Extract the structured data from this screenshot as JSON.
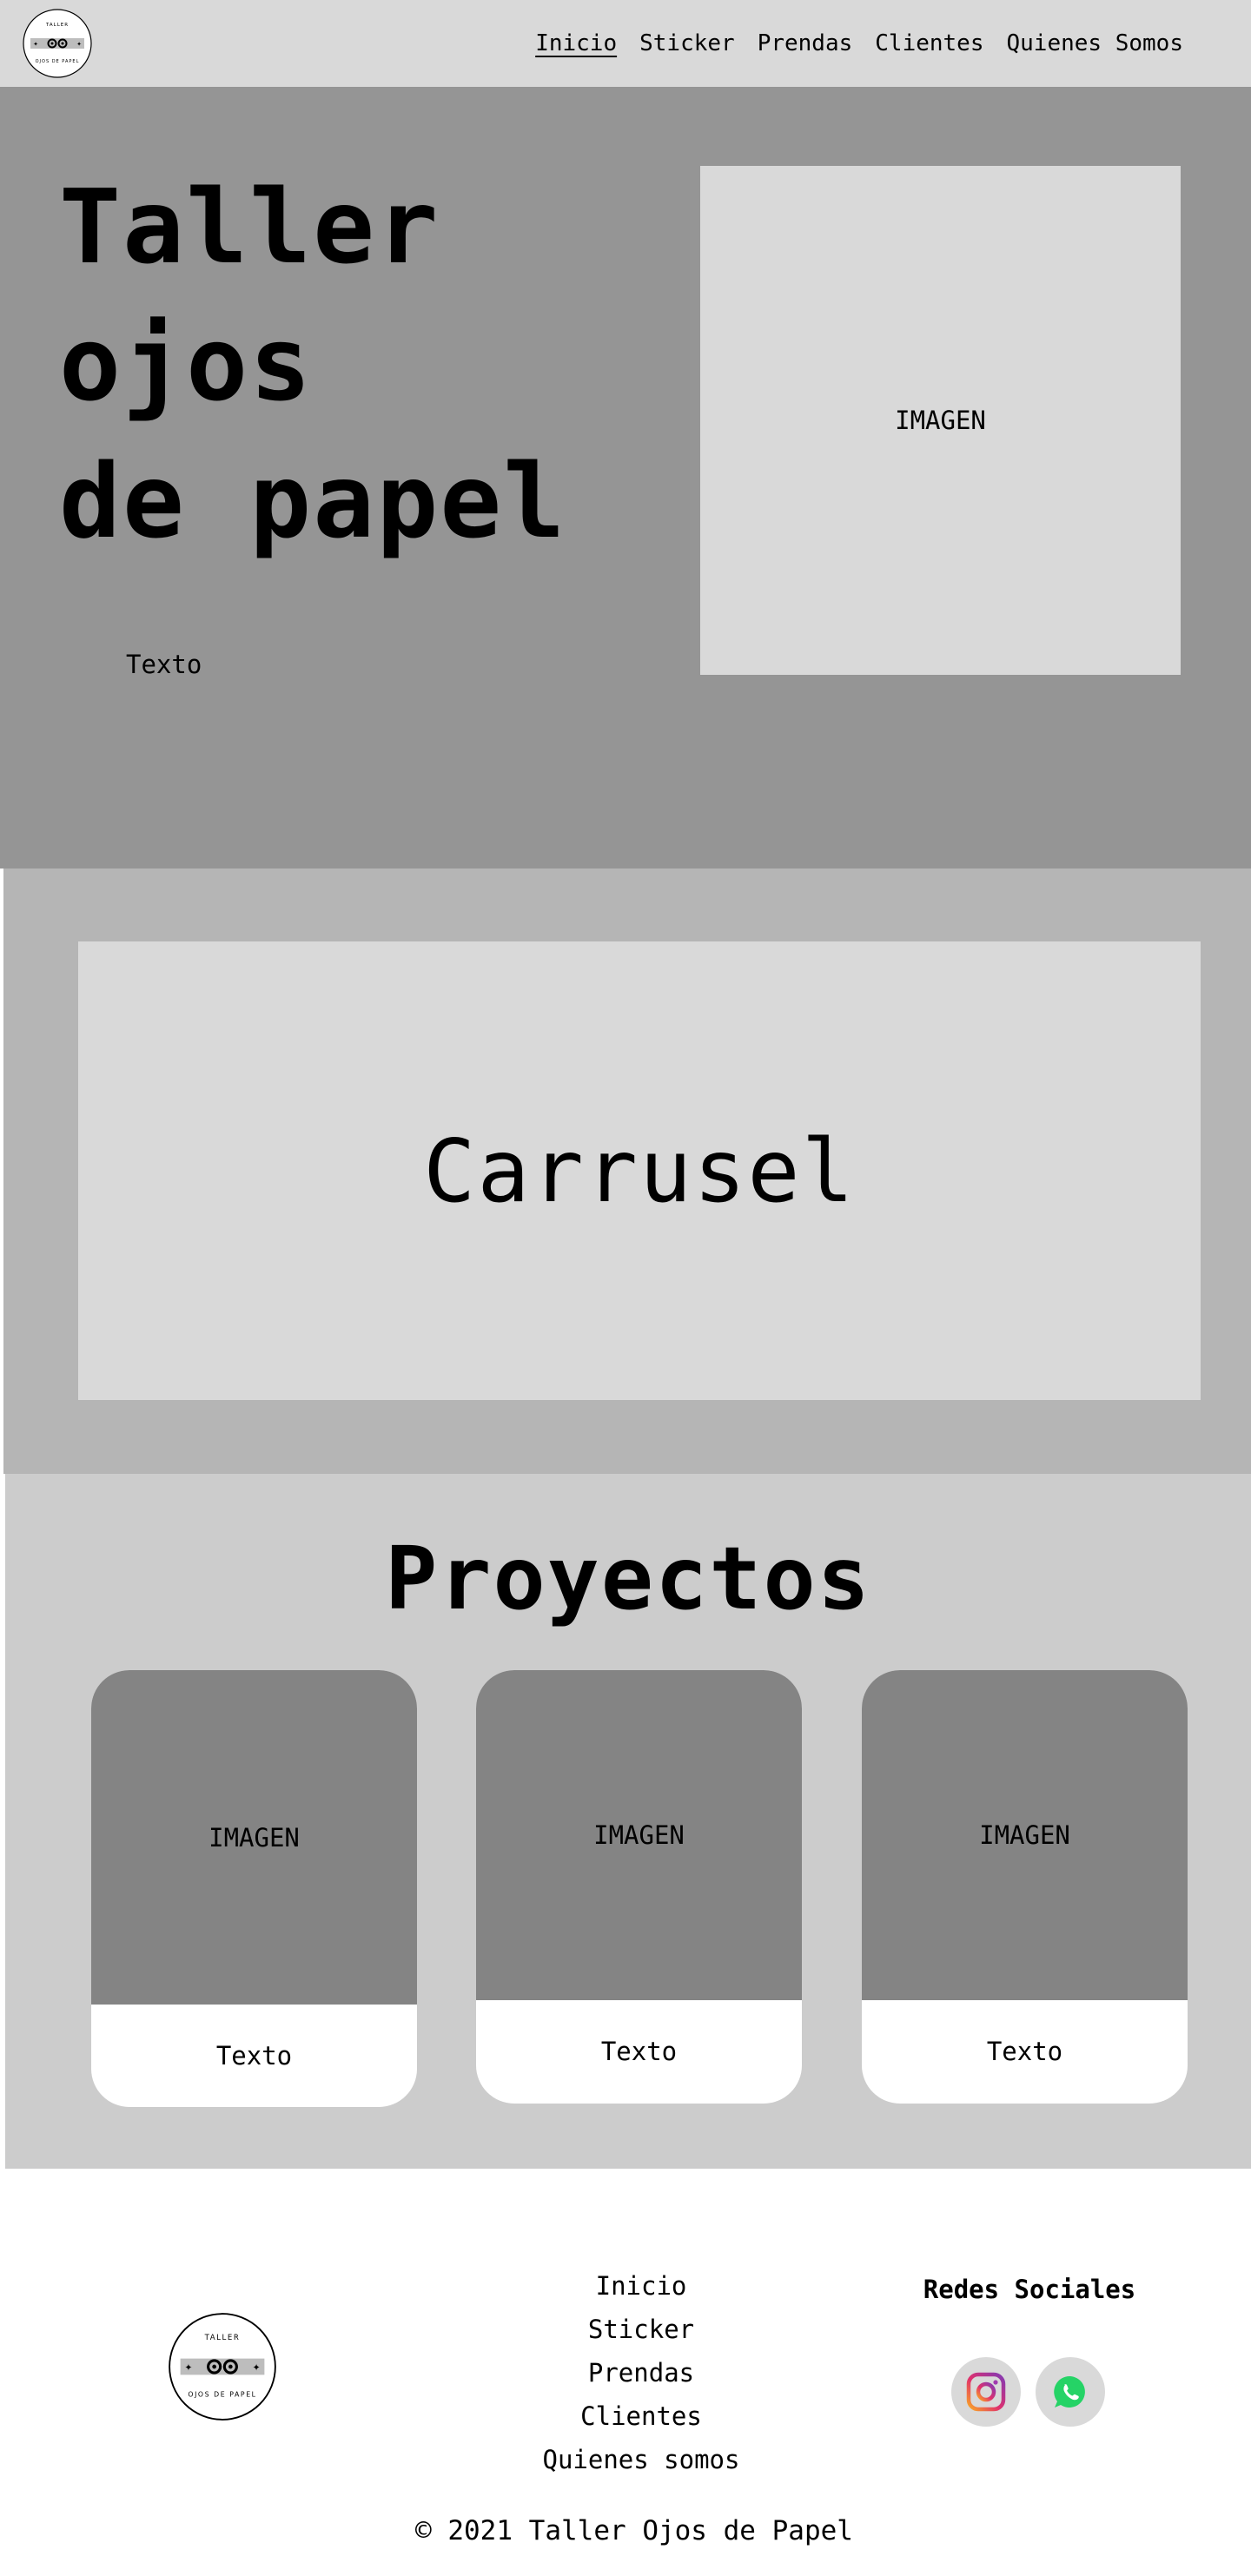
{
  "nav": {
    "logo_text_top": "TALLER",
    "logo_text_bottom": "OJOS DE PAPEL",
    "links": [
      "Inicio",
      "Sticker",
      "Prendas",
      "Clientes",
      "Quienes Somos"
    ],
    "active": "Inicio"
  },
  "hero": {
    "title_lines": [
      "Taller",
      "ojos",
      "de papel"
    ],
    "text": "Texto",
    "image_label": "IMAGEN"
  },
  "carousel": {
    "label": "Carrusel"
  },
  "projects": {
    "title": "Proyectos",
    "cards": [
      {
        "image_label": "IMAGEN",
        "text": "Texto"
      },
      {
        "image_label": "IMAGEN",
        "text": "Texto"
      },
      {
        "image_label": "IMAGEN",
        "text": "Texto"
      }
    ]
  },
  "footer": {
    "logo_text_top": "TALLER",
    "logo_text_bottom": "OJOS DE PAPEL",
    "links": [
      "Inicio",
      "Sticker",
      "Prendas",
      "Clientes",
      "Quienes somos"
    ],
    "social_title": "Redes Sociales",
    "social": [
      {
        "name": "instagram-icon"
      },
      {
        "name": "whatsapp-icon"
      }
    ],
    "copyright": "© 2021 Taller Ojos de Papel"
  },
  "colors": {
    "nav_bg": "#d9d9d9",
    "hero_bg": "#959595",
    "carousel_section_bg": "#b5b5b5",
    "projects_bg": "#cccccc",
    "card_image_bg": "#848484",
    "whatsapp_green": "#25d366"
  }
}
